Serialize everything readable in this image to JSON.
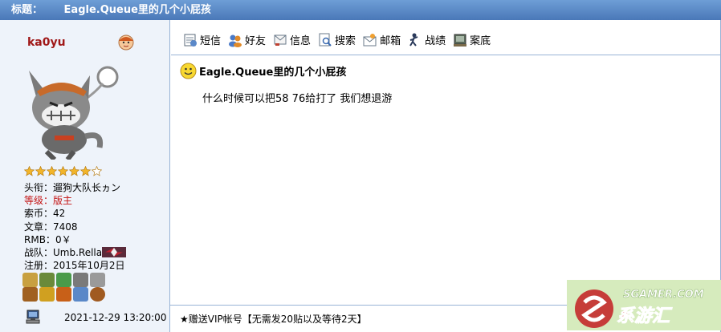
{
  "title_bar": {
    "label": "标题：",
    "title": "Eagle.Queue里的几个小屁孩"
  },
  "user": {
    "name": "ka0yu",
    "stars_filled": 6,
    "stars_total": 7,
    "profile": [
      {
        "key": "头衔：",
        "value": "遛狗大队长ヵン"
      },
      {
        "key": "等级：",
        "value": "版主"
      },
      {
        "key": "索币：",
        "value": "42"
      },
      {
        "key": "文章：",
        "value": "7408"
      },
      {
        "key": "RMB：",
        "value": "0￥"
      },
      {
        "key": "战队：",
        "value": "Umb.Rella"
      },
      {
        "key": "注册：",
        "value": "2015年10月2日"
      }
    ],
    "medal_colors": [
      "#c8a040",
      "#6a8a3a",
      "#4a9a4a",
      "#7a7a7a",
      "#9a9a9a",
      "#a06020",
      "#d0a020",
      "#c86018",
      "#5a88c8",
      "#a05a20"
    ]
  },
  "toolbar": [
    {
      "label": "短信",
      "icon": "message-icon"
    },
    {
      "label": "好友",
      "icon": "friends-icon"
    },
    {
      "label": "信息",
      "icon": "info-icon"
    },
    {
      "label": "搜索",
      "icon": "search-icon"
    },
    {
      "label": "邮箱",
      "icon": "mail-icon"
    },
    {
      "label": "战绩",
      "icon": "record-icon"
    },
    {
      "label": "案底",
      "icon": "history-icon"
    }
  ],
  "post": {
    "title": "Eagle.Queue里的几个小屁孩",
    "content": "什么时候可以把58 76给打了   我们想退游",
    "time": "2021-12-29 13:20:00",
    "signature": "★赠送VIP帐号【无需发20贴以及等待2天】"
  },
  "watermark": {
    "line1": "SGAMER.COM",
    "line2": "系游汇"
  },
  "colors": {
    "title_bar": "#5a88c8",
    "left_bg": "#eef3fa",
    "border": "#98b3d6",
    "username": "#a01818",
    "rank_red": "#c41414"
  }
}
